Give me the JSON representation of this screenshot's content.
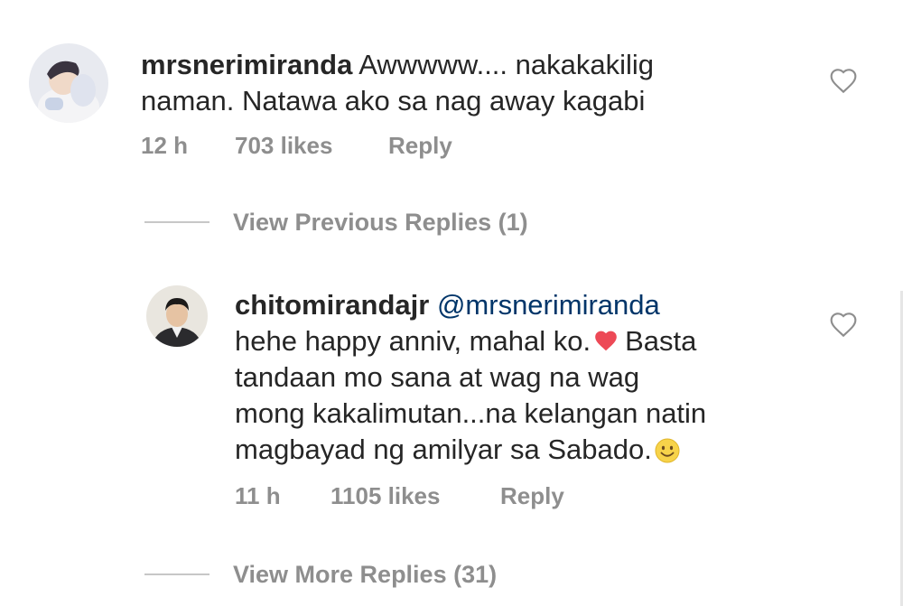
{
  "comment": {
    "username": "mrsnerimiranda",
    "text_line1": "Awwwww.... nakakakilig",
    "text_line2": "naman. Natawa ako sa nag away kagabi",
    "time": "12 h",
    "likes": "703 likes",
    "reply_label": "Reply",
    "like_icon": "heart-outline-icon"
  },
  "view_previous": "View Previous Replies (1)",
  "reply": {
    "username": "chitomirandajr",
    "mention": "@mrsnerimiranda",
    "line1_before": "hehe happy anniv, mahal ko.",
    "line1_after": "Basta",
    "line2": "tandaan mo sana at wag na wag",
    "line3": "mong kakalimutan...na kelangan natin",
    "line4": "magbayad ng amilyar sa Sabado.",
    "time": "11 h",
    "likes": "1105 likes",
    "reply_label": "Reply",
    "like_icon": "heart-outline-icon"
  },
  "view_more": "View More Replies (31)",
  "colors": {
    "text": "#262626",
    "meta": "#8e8e8e",
    "mention": "#003569",
    "heart": "#ed4956"
  }
}
